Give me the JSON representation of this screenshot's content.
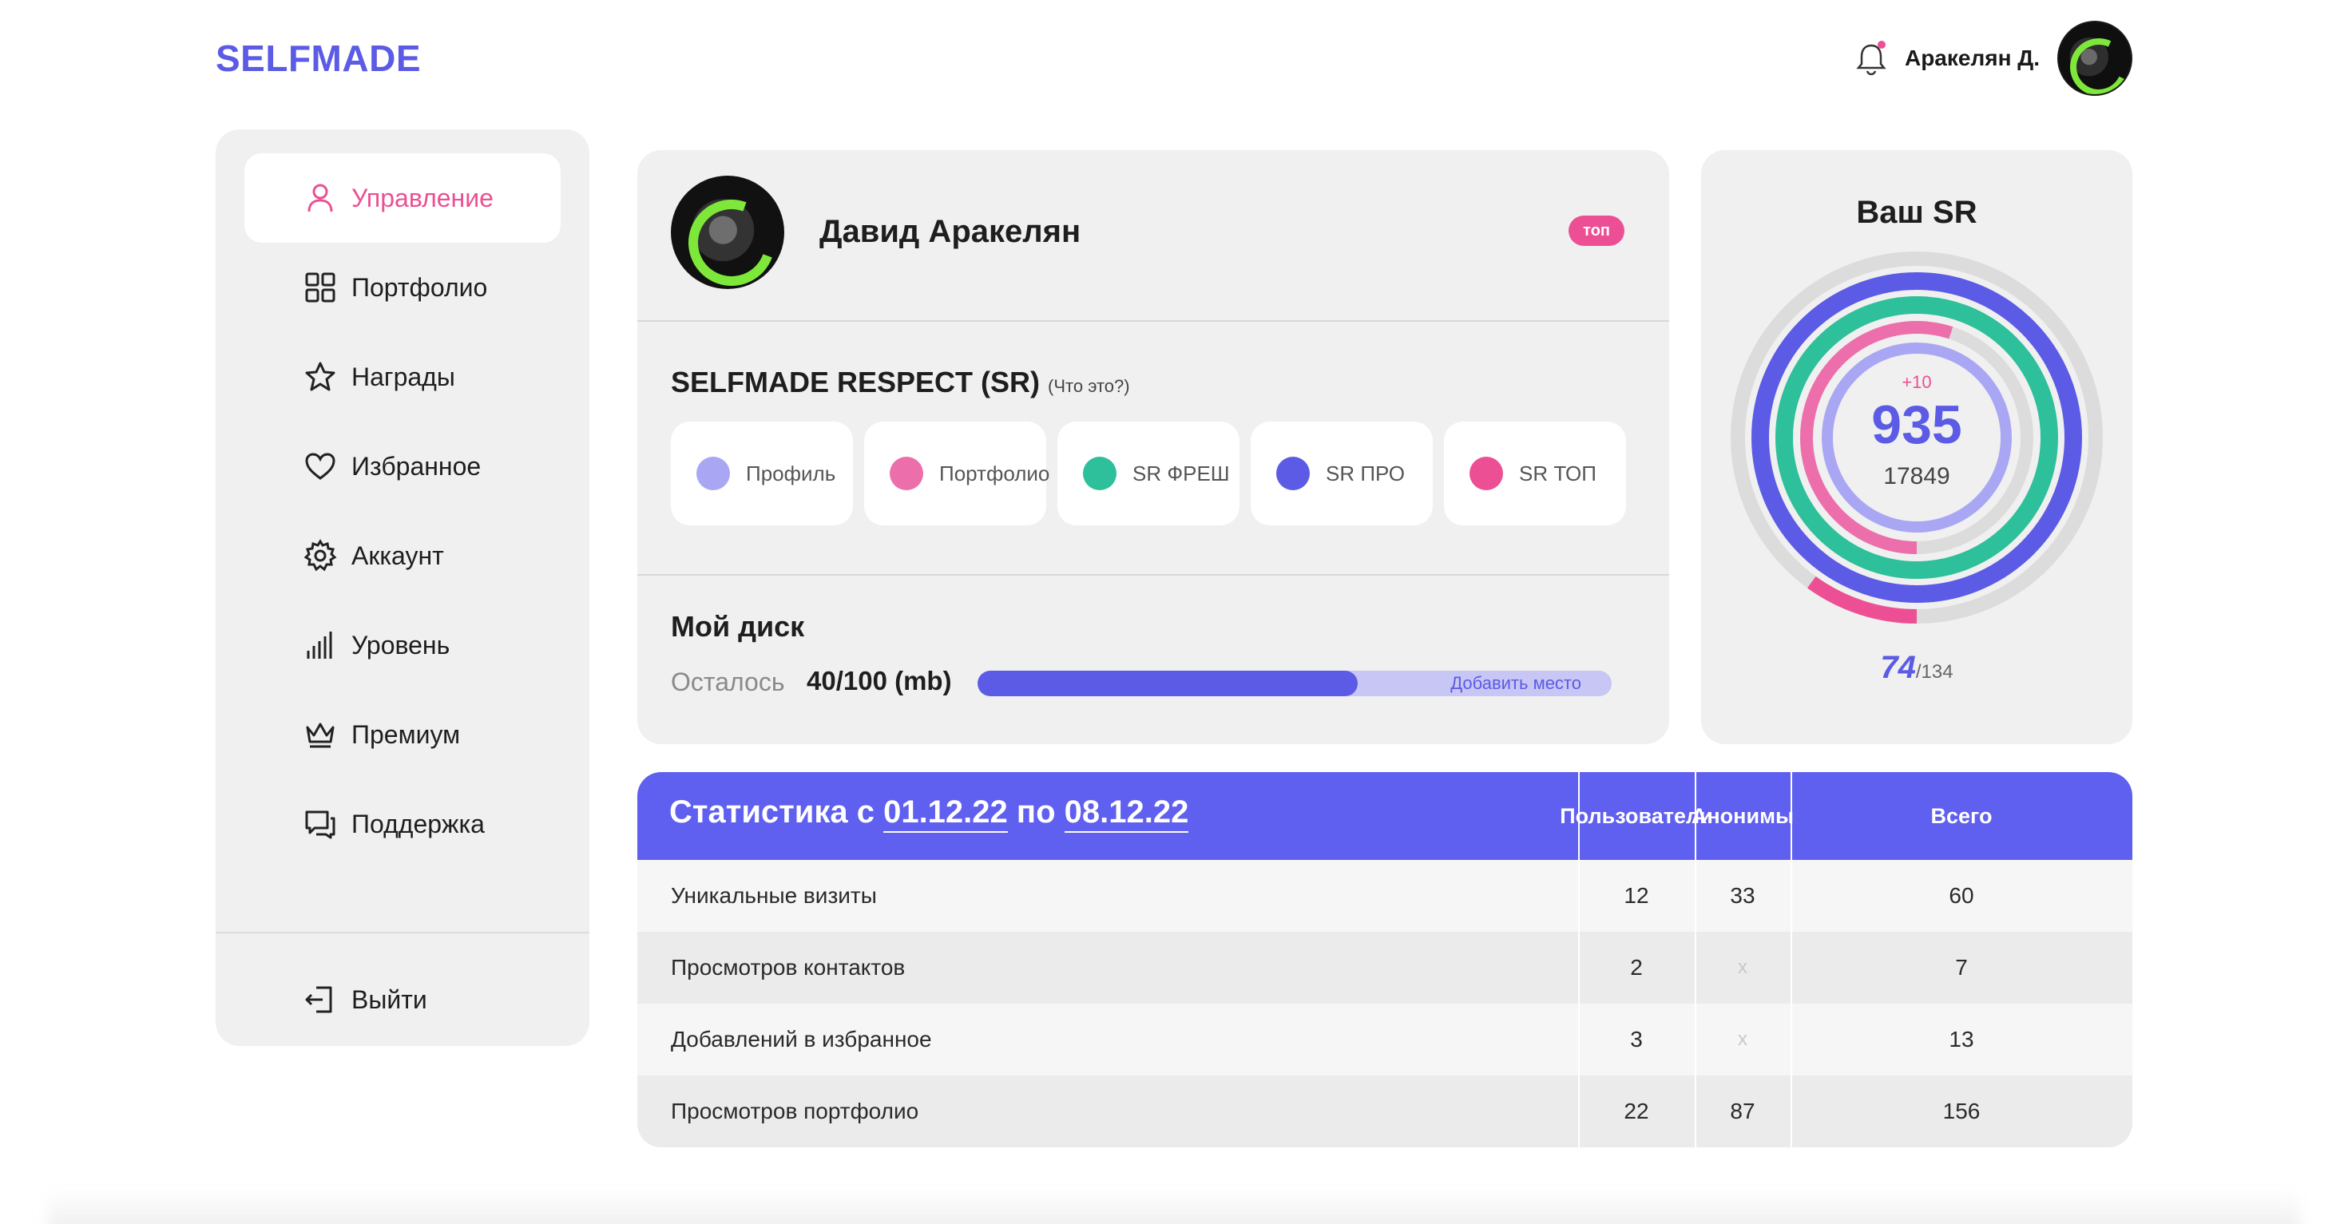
{
  "logo": "SELFMADE",
  "header": {
    "user_name": "Аракелян Д."
  },
  "sidebar": {
    "items": [
      {
        "label": "Управление",
        "icon": "user-icon",
        "active": true
      },
      {
        "label": "Портфолио",
        "icon": "grid-icon"
      },
      {
        "label": "Награды",
        "icon": "star-icon"
      },
      {
        "label": "Избранное",
        "icon": "heart-icon"
      },
      {
        "label": "Аккаунт",
        "icon": "gear-icon"
      },
      {
        "label": "Уровень",
        "icon": "bars-icon"
      },
      {
        "label": "Премиум",
        "icon": "crown-icon"
      },
      {
        "label": "Поддержка",
        "icon": "chat-icon"
      }
    ],
    "logout": "Выйти"
  },
  "profile": {
    "name": "Давид Аракелян",
    "badge": "топ",
    "sr_title": "SELFMADE RESPECT (SR)",
    "sr_hint": "(Что это?)",
    "sr_chips": [
      {
        "label": "Профиль",
        "color": "#a9a7f4"
      },
      {
        "label": "Портфолио",
        "color": "#ec6fac"
      },
      {
        "label": "SR ФРЕШ",
        "color": "#2ec09a"
      },
      {
        "label": "SR ПРО",
        "color": "#5b5be6"
      },
      {
        "label": "SR ТОП",
        "color": "#ec4f93"
      }
    ],
    "disk": {
      "title": "Мой диск",
      "left_label": "Осталось",
      "value": "40/100 (mb)",
      "fill_fraction": 0.6,
      "add_label": "Добавить место"
    }
  },
  "sr": {
    "title": "Ваш SR",
    "delta": "+10",
    "value": "935",
    "total": "17849",
    "level": "74",
    "level_total": "/134",
    "rings": [
      {
        "name": "outer-gray-pink",
        "color": "#ec4f93",
        "fraction": 0.1
      },
      {
        "name": "blue",
        "color": "#5b5be6",
        "fraction": 1.0
      },
      {
        "name": "green",
        "color": "#2ec09a",
        "fraction": 1.0
      },
      {
        "name": "pink",
        "color": "#ec6fac",
        "fraction": 0.55
      },
      {
        "name": "lavender",
        "color": "#a9a7f4",
        "fraction": 1.0
      }
    ]
  },
  "stats": {
    "title_prefix": "Статистика с",
    "date_from": "01.12.22",
    "title_mid": "по",
    "date_to": "08.12.22",
    "columns": [
      "Пользователи",
      "Анонимы",
      "Всего"
    ],
    "rows": [
      {
        "label": "Уникальные визиты",
        "values": [
          "12",
          "33",
          "60"
        ]
      },
      {
        "label": "Просмотров контактов",
        "values": [
          "2",
          "x",
          "7"
        ]
      },
      {
        "label": "Добавлений в избранное",
        "values": [
          "3",
          "x",
          "13"
        ]
      },
      {
        "label": "Просмотров портфолио",
        "values": [
          "22",
          "87",
          "156"
        ]
      }
    ]
  }
}
